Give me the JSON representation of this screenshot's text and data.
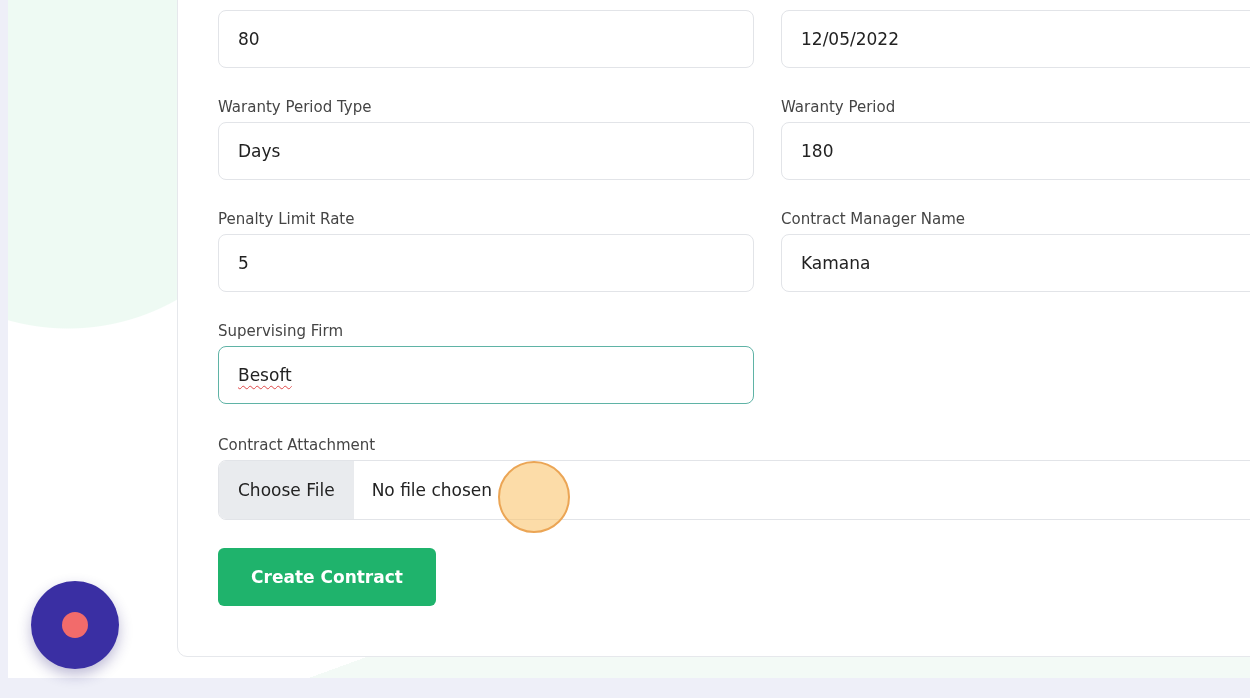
{
  "form": {
    "rows": [
      [
        {
          "value": "80",
          "focused": false,
          "misspelled": false
        },
        {
          "value": "12/05/2022",
          "focused": false,
          "misspelled": false
        }
      ],
      [
        {
          "label": "Waranty Period Type",
          "value": "Days",
          "focused": false,
          "misspelled": false
        },
        {
          "label": "Waranty Period",
          "value": "180",
          "focused": false,
          "misspelled": false
        }
      ],
      [
        {
          "label": "Penalty Limit Rate",
          "value": "5",
          "focused": false,
          "misspelled": false
        },
        {
          "label": "Contract Manager Name",
          "value": "Kamana",
          "focused": false,
          "misspelled": false
        }
      ],
      [
        {
          "label": "Supervising Firm",
          "value": "Besoft",
          "focused": true,
          "misspelled": true
        }
      ]
    ],
    "attachment": {
      "label": "Contract Attachment",
      "button": "Choose File",
      "status": "No file chosen"
    },
    "submit": "Create Contract"
  }
}
